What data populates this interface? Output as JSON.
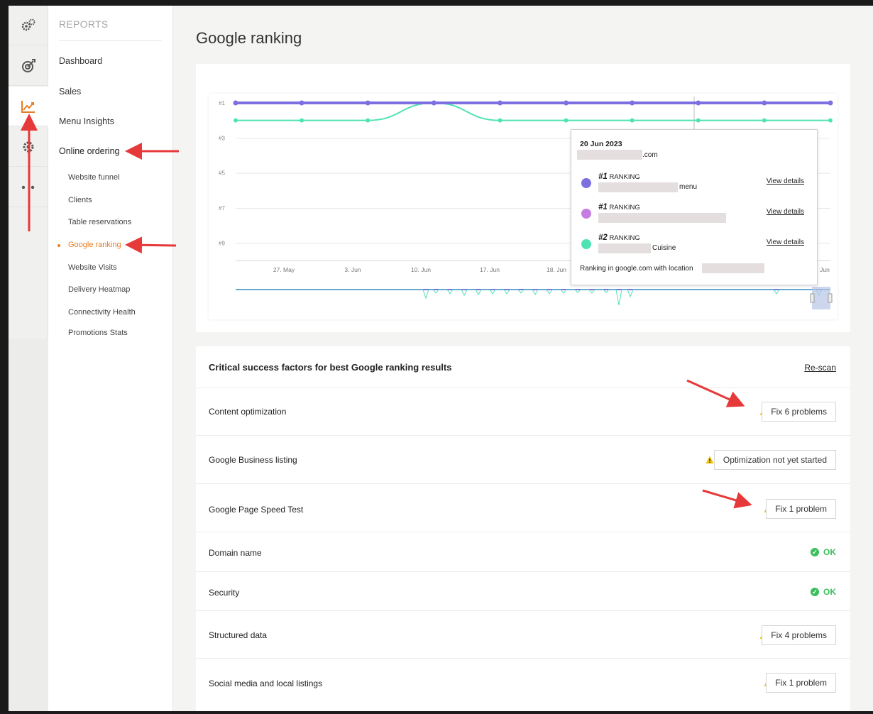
{
  "sidebar": {
    "section_title": "REPORTS",
    "items": [
      {
        "label": "Dashboard"
      },
      {
        "label": "Sales"
      },
      {
        "label": "Menu Insights"
      },
      {
        "label": "Online ordering"
      }
    ],
    "children": [
      {
        "label": "Website funnel"
      },
      {
        "label": "Clients"
      },
      {
        "label": "Table reservations"
      },
      {
        "label": "Google ranking"
      },
      {
        "label": "Website Visits"
      },
      {
        "label": "Delivery Heatmap"
      },
      {
        "label": "Connectivity Health"
      },
      {
        "label": "Promotions Stats"
      }
    ],
    "rail_icons": [
      "gears-icon",
      "target-icon",
      "chart-line-icon",
      "gear-icon",
      "more-icon"
    ]
  },
  "page": {
    "title": "Google ranking"
  },
  "chart_data": {
    "type": "line",
    "y_ticks": [
      "#1",
      "#3",
      "#5",
      "#7",
      "#9"
    ],
    "x_ticks": [
      "27. May",
      "3. Jun",
      "10. Jun",
      "17. Jun",
      "18. Jun",
      "Jun"
    ],
    "series": [
      {
        "color": "#7c6fe0",
        "values": [
          1,
          1,
          1,
          1,
          1,
          1,
          1,
          1,
          1,
          1
        ]
      },
      {
        "color": "#c77de0",
        "values": [
          1,
          1,
          1,
          1,
          1,
          1,
          1,
          1,
          1,
          1
        ]
      },
      {
        "color": "#4fe3b4",
        "values": [
          2,
          2,
          2,
          1,
          2,
          2,
          2,
          2,
          2,
          2
        ]
      }
    ],
    "ylim": [
      1,
      10
    ]
  },
  "tooltip": {
    "date": "20 Jun 2023",
    "domain_suffix": ".com",
    "rows": [
      {
        "rank": "#1",
        "rank_label": "RANKING",
        "suffix": "menu",
        "link": "View details",
        "color": "#7c6fe0"
      },
      {
        "rank": "#1",
        "rank_label": "RANKING",
        "suffix": "",
        "link": "View details",
        "color": "#c77de0"
      },
      {
        "rank": "#2",
        "rank_label": "RANKING",
        "suffix": "Cuisine",
        "link": "View details",
        "color": "#4fe3b4"
      }
    ],
    "footer": "Ranking in google.com with location"
  },
  "factors": {
    "title": "Critical success factors for best Google ranking results",
    "rescan": "Re-scan",
    "rows": [
      {
        "label": "Content optimization",
        "status": "Fix 6 problems"
      },
      {
        "label": "Google Business listing",
        "status": "Optimization not yet started"
      },
      {
        "label": "Google Page Speed Test",
        "status": "Fix 1 problem"
      },
      {
        "label": "Domain name",
        "status": "OK"
      },
      {
        "label": "Security",
        "status": "OK"
      },
      {
        "label": "Structured data",
        "status": "Fix 4 problems"
      },
      {
        "label": "Social media and local listings",
        "status": "Fix 1 problem"
      }
    ]
  },
  "colors": {
    "accent": "#e67e22",
    "ok": "#3bbf5e",
    "warn": "#f2c200",
    "annotation": "#e63939"
  }
}
